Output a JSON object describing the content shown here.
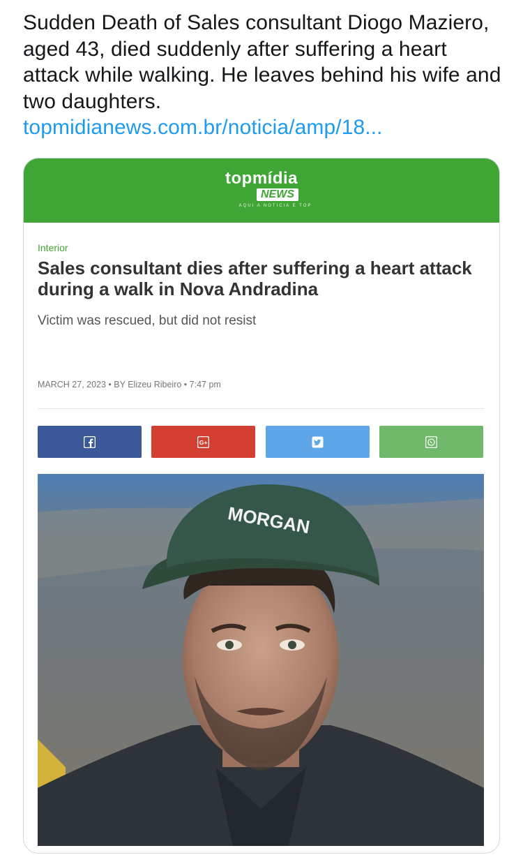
{
  "tweet": {
    "text": "Sudden Death of Sales consultant Diogo Maziero, aged 43, died suddenly after suffering a heart attack while walking. He leaves behind his wife and two daughters.",
    "link": "topmidianews.com.br/noticia/amp/18..."
  },
  "card": {
    "logo": {
      "top": "topmídia",
      "news": "NEWS",
      "tagline": "AQUI A NOTÍCIA É TOP"
    },
    "category": "Interior",
    "headline": "Sales consultant dies after suffering a heart attack during a walk in Nova Andradina",
    "subheadline": "Victim was rescued, but did not resist",
    "meta": "MARCH 27, 2023 • BY Elizeu Ribeiro • 7:47 pm",
    "share_buttons": [
      {
        "icon": "facebook-icon",
        "color": "#3b5998"
      },
      {
        "icon": "google-plus-icon",
        "color": "#d23f31"
      },
      {
        "icon": "twitter-icon",
        "color": "#5fa6e8"
      },
      {
        "icon": "whatsapp-icon",
        "color": "#70b86a"
      }
    ],
    "photo_cap_text": "MORGAN"
  },
  "colors": {
    "brand_green": "#3fa535",
    "link_blue": "#1d9bf0"
  }
}
